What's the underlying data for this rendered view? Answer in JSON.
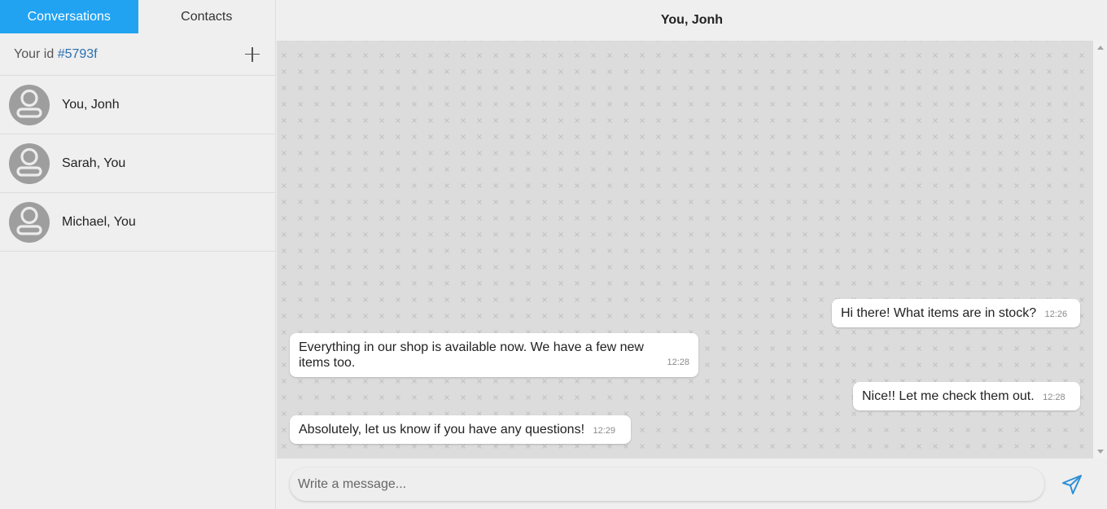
{
  "tabs": {
    "conversations": "Conversations",
    "contacts": "Contacts"
  },
  "identity": {
    "label": "Your id",
    "value": "#5793f"
  },
  "conversations": [
    {
      "name": "You, Jonh"
    },
    {
      "name": "Sarah, You"
    },
    {
      "name": "Michael, You"
    }
  ],
  "chat": {
    "title": "You, Jonh",
    "messages": [
      {
        "text": "Hi there! What items are in stock?",
        "time": "12:26",
        "side": "out"
      },
      {
        "text": "Everything in our shop is available now. We have a few new items too.",
        "time": "12:28",
        "side": "in"
      },
      {
        "text": "Nice!! Let me check them out.",
        "time": "12:28",
        "side": "out"
      },
      {
        "text": "Absolutely, let us know if you have any questions!",
        "time": "12:29",
        "side": "in"
      }
    ]
  },
  "composer": {
    "placeholder": "Write a message..."
  },
  "colors": {
    "accent": "#21a3f1",
    "id_link": "#2a6fb0",
    "chat_bg": "#dcdcdc"
  },
  "icons": {
    "add": "plus-icon",
    "avatar": "user-avatar-icon",
    "send": "send-icon"
  }
}
